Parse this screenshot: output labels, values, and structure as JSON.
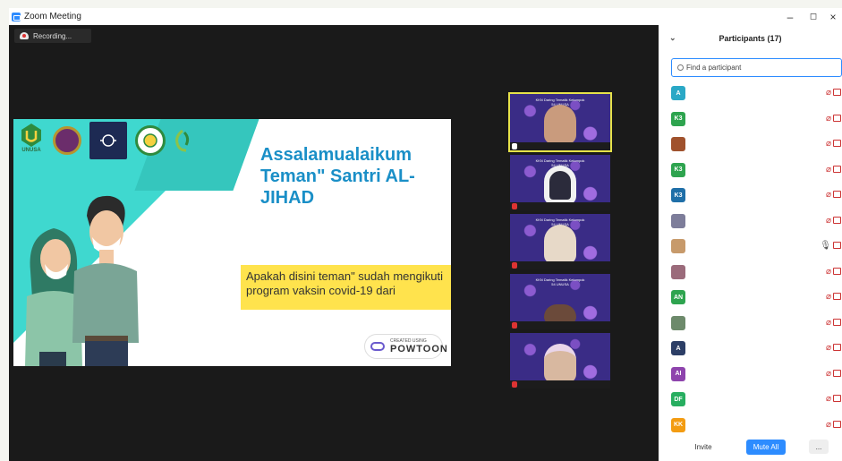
{
  "window": {
    "title": "Zoom Meeting",
    "controls": [
      "–",
      "◻",
      "×"
    ]
  },
  "meeting": {
    "recording_label": "Recording..."
  },
  "slide": {
    "title": "Assalamualaikum Teman\" Santri AL-JIHAD",
    "question": "Apakah disini teman\" sudah mengikuti program vaksin covid-19 dari",
    "logo_text": "UNUSA",
    "powtoon_small": "CREATED USING",
    "powtoon_big": "POWTOON"
  },
  "gallery": {
    "tile_banner": "KKN Daring Tematik Kelompok 54 UNUSA"
  },
  "participants": {
    "header": "Participants (17)",
    "search_placeholder": "Find a participant",
    "rows": [
      {
        "avatar": "A",
        "color": "#2aa8c6"
      },
      {
        "avatar": "K3",
        "color": "#2ea44f"
      },
      {
        "avatar": "",
        "color": "#a0522d"
      },
      {
        "avatar": "K3",
        "color": "#2ea44f"
      },
      {
        "avatar": "K3",
        "color": "#1f6fa8"
      },
      {
        "avatar": "",
        "color": "#7d7d9a"
      },
      {
        "avatar": "",
        "color": "#c79a6b"
      },
      {
        "avatar": "",
        "color": "#9b6b7b"
      },
      {
        "avatar": "AN",
        "color": "#2ea44f"
      },
      {
        "avatar": "",
        "color": "#6d8a6b"
      },
      {
        "avatar": "A",
        "color": "#2c3e66"
      },
      {
        "avatar": "AI",
        "color": "#8e44ad"
      },
      {
        "avatar": "DF",
        "color": "#27ae60"
      },
      {
        "avatar": "KK",
        "color": "#f39c12"
      }
    ],
    "invite_label": "Invite",
    "mute_all_label": "Mute All",
    "more_label": "..."
  }
}
